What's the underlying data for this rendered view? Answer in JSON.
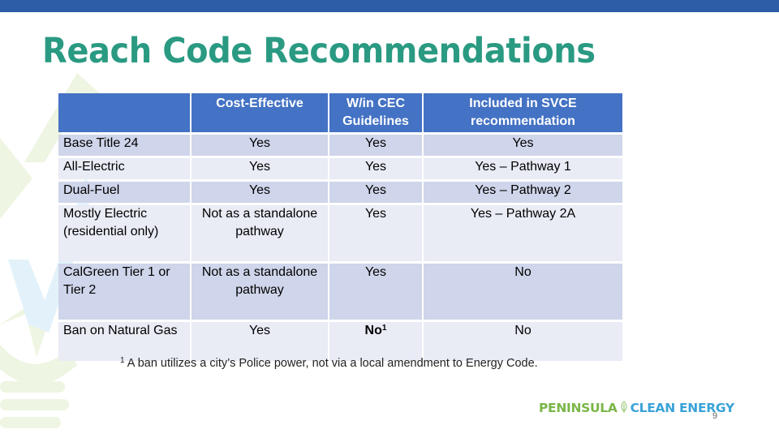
{
  "slide": {
    "title": "Reach Code Recommendations",
    "page_number": "9",
    "colors": {
      "top_bar": "#2e5da8",
      "title": "#2a9a82",
      "header_fill": "#4472c4",
      "row_dark": "#cfd5ea",
      "row_light": "#e9ebf5",
      "logo_green": "#7ab648",
      "logo_blue": "#3aa3d8"
    }
  },
  "table": {
    "headers": [
      "",
      "Cost-Effective",
      "W/in CEC Guidelines",
      "Included in SVCE recommendation"
    ],
    "rows": [
      {
        "label": "Base Title 24",
        "cost_effective": "Yes",
        "cec": "Yes",
        "cec_sup": "",
        "svce": "Yes"
      },
      {
        "label": "All-Electric",
        "cost_effective": "Yes",
        "cec": "Yes",
        "cec_sup": "",
        "svce": "Yes – Pathway 1"
      },
      {
        "label": "Dual-Fuel",
        "cost_effective": "Yes",
        "cec": "Yes",
        "cec_sup": "",
        "svce": "Yes – Pathway 2"
      },
      {
        "label": "Mostly Electric (residential only)",
        "cost_effective": "Not as a standalone pathway",
        "cec": "Yes",
        "cec_sup": "",
        "svce": "Yes – Pathway 2A"
      },
      {
        "label": "CalGreen Tier 1 or Tier 2",
        "cost_effective": "Not as a standalone pathway",
        "cec": "Yes",
        "cec_sup": "",
        "svce": "No"
      },
      {
        "label": "Ban on Natural Gas",
        "cost_effective": "Yes",
        "cec": "No",
        "cec_sup": "1",
        "svce": "No"
      }
    ]
  },
  "footnote": {
    "marker": "1",
    "text": " A ban utilizes a city’s Police power, not via a local amendment to Energy Code."
  },
  "logo": {
    "part1": "PENINSULA",
    "icon": "leaf-icon",
    "part2": "CLEAN ENERGY"
  }
}
